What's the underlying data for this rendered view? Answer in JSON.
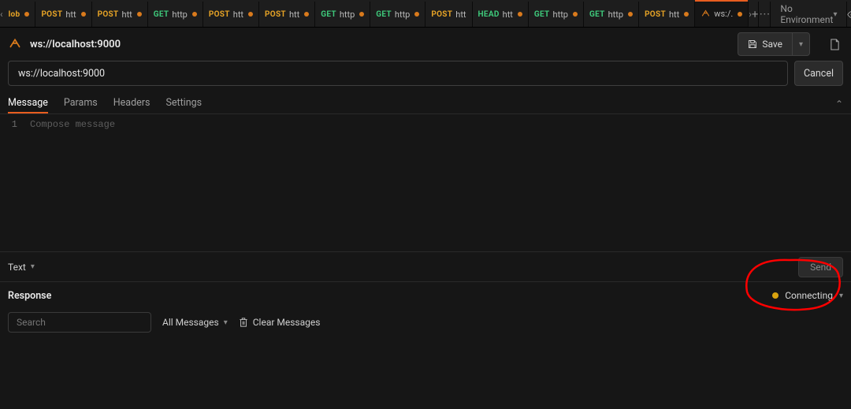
{
  "tabbar": {
    "tabs": [
      {
        "method": "lob",
        "cls": "POST",
        "label": "",
        "dirty": true
      },
      {
        "method": "POST",
        "cls": "POST",
        "label": "htt",
        "dirty": true
      },
      {
        "method": "POST",
        "cls": "POST",
        "label": "htt",
        "dirty": true
      },
      {
        "method": "GET",
        "cls": "GET",
        "label": "http",
        "dirty": true
      },
      {
        "method": "POST",
        "cls": "POST",
        "label": "htt",
        "dirty": true
      },
      {
        "method": "POST",
        "cls": "POST",
        "label": "htt",
        "dirty": true
      },
      {
        "method": "GET",
        "cls": "GET",
        "label": "http",
        "dirty": true
      },
      {
        "method": "GET",
        "cls": "GET",
        "label": "http",
        "dirty": true
      },
      {
        "method": "POST",
        "cls": "POST",
        "label": "htt",
        "dirty": false
      },
      {
        "method": "HEAD",
        "cls": "HEAD",
        "label": "htt",
        "dirty": true
      },
      {
        "method": "GET",
        "cls": "GET",
        "label": "http",
        "dirty": true
      },
      {
        "method": "GET",
        "cls": "GET",
        "label": "http",
        "dirty": true
      },
      {
        "method": "POST",
        "cls": "POST",
        "label": "htt",
        "dirty": true
      }
    ],
    "active": {
      "label": "ws:/.",
      "dirty": true
    },
    "env_label": "No Environment"
  },
  "request": {
    "title": "ws://localhost:9000",
    "url": "ws://localhost:9000",
    "save_label": "Save",
    "cancel_label": "Cancel"
  },
  "msgtabs": {
    "message": "Message",
    "params": "Params",
    "headers": "Headers",
    "settings": "Settings"
  },
  "editor": {
    "line": "1",
    "placeholder": "Compose message"
  },
  "msgfoot": {
    "format": "Text",
    "send": "Send"
  },
  "response": {
    "label": "Response",
    "status": "Connecting",
    "search_placeholder": "Search",
    "filter": "All Messages",
    "clear": "Clear Messages"
  }
}
